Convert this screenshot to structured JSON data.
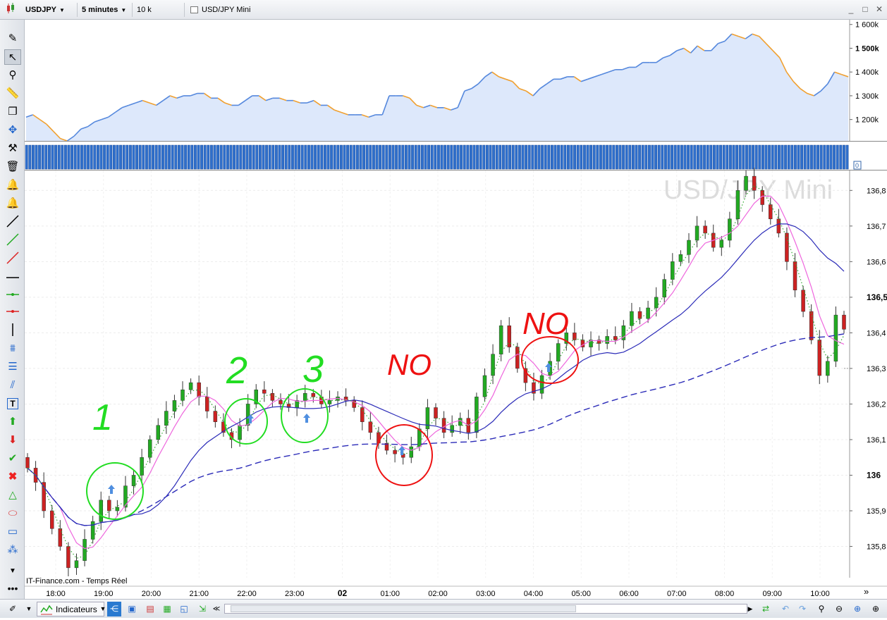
{
  "toolbar": {
    "symbol": "USDJPY",
    "timeframe": "5 minutes",
    "units": "10 k unités",
    "title": "USD/JPY Mini",
    "winbtns": [
      "_",
      "□",
      "✕"
    ]
  },
  "colors": {
    "up": "#22aa22",
    "down": "#cc2222",
    "ma_fast": "#ee66dd",
    "ma_slow": "#2b2bb8",
    "ma_long": "#2b2bb8",
    "dotted_green": "#33aa33",
    "equity_fill": "#dde8fb",
    "equity_line_up": "#5588dd",
    "equity_line_down": "#f0a030",
    "volume_bar": "#2f6fcc",
    "annotation_green": "#22dd22",
    "annotation_red": "#ee1111"
  },
  "chart_data": [
    {
      "type": "area",
      "name": "equity",
      "y_ticks": [
        "1 600k",
        "1 500k",
        "1 400k",
        "1 300k",
        "1 200k"
      ],
      "y_tick_values": [
        1600,
        1500,
        1400,
        1300,
        1200
      ],
      "y_bold": "1 500k",
      "ylim": [
        1110,
        1620
      ],
      "values": [
        1210,
        1220,
        1200,
        1180,
        1150,
        1120,
        1110,
        1130,
        1160,
        1170,
        1190,
        1200,
        1210,
        1230,
        1250,
        1260,
        1270,
        1280,
        1270,
        1260,
        1280,
        1300,
        1290,
        1300,
        1300,
        1310,
        1310,
        1290,
        1290,
        1270,
        1260,
        1260,
        1280,
        1300,
        1300,
        1280,
        1290,
        1290,
        1280,
        1280,
        1270,
        1270,
        1280,
        1260,
        1260,
        1240,
        1230,
        1220,
        1220,
        1220,
        1210,
        1220,
        1220,
        1300,
        1300,
        1300,
        1290,
        1260,
        1250,
        1260,
        1250,
        1250,
        1240,
        1250,
        1320,
        1330,
        1350,
        1380,
        1400,
        1380,
        1370,
        1360,
        1330,
        1320,
        1300,
        1330,
        1350,
        1370,
        1370,
        1380,
        1380,
        1360,
        1370,
        1380,
        1390,
        1400,
        1410,
        1410,
        1420,
        1420,
        1440,
        1440,
        1440,
        1460,
        1470,
        1490,
        1500,
        1480,
        1510,
        1490,
        1490,
        1520,
        1530,
        1560,
        1550,
        1540,
        1560,
        1550,
        1520,
        1490,
        1460,
        1400,
        1360,
        1330,
        1310,
        1300,
        1320,
        1350,
        1400,
        1390,
        1380
      ]
    },
    {
      "type": "bar",
      "name": "volume",
      "y_tick": "0"
    },
    {
      "type": "candlestick",
      "name": "USDJPY 5 minutes",
      "watermark": "USD/JPY Mini",
      "y_ticks": [
        "136,8",
        "136,7",
        "136,6",
        "136,5",
        "136,4",
        "136,3",
        "136,2",
        "136,1",
        "136",
        "135,9",
        "135,8"
      ],
      "y_tick_values": [
        136.8,
        136.7,
        136.6,
        136.5,
        136.4,
        136.3,
        136.2,
        136.1,
        136.0,
        135.9,
        135.8
      ],
      "y_bold": [
        "136,5",
        "136"
      ],
      "ylim": [
        135.712,
        136.856
      ],
      "x_ticks": [
        "18:00",
        "19:00",
        "20:00",
        "21:00",
        "22:00",
        "23:00",
        "02",
        "01:00",
        "02:00",
        "03:00",
        "04:00",
        "05:00",
        "06:00",
        "07:00",
        "08:00",
        "09:00",
        "10:00"
      ],
      "x_tick_bold": "02",
      "close": [
        136.02,
        135.98,
        135.9,
        135.85,
        135.8,
        135.74,
        135.76,
        135.82,
        135.87,
        135.93,
        135.9,
        135.91,
        135.97,
        136.0,
        136.05,
        136.1,
        136.14,
        136.18,
        136.21,
        136.24,
        136.26,
        136.22,
        136.18,
        136.15,
        136.12,
        136.1,
        136.14,
        136.2,
        136.24,
        136.23,
        136.21,
        136.2,
        136.19,
        136.21,
        136.23,
        136.22,
        136.2,
        136.21,
        136.22,
        136.21,
        136.19,
        136.15,
        136.12,
        136.09,
        136.07,
        136.06,
        136.05,
        136.08,
        136.13,
        136.19,
        136.16,
        136.12,
        136.14,
        136.16,
        136.12,
        136.22,
        136.28,
        136.34,
        136.42,
        136.36,
        136.3,
        136.26,
        136.23,
        136.28,
        136.32,
        136.37,
        136.4,
        136.38,
        136.36,
        136.38,
        136.37,
        136.39,
        136.38,
        136.42,
        136.46,
        136.44,
        136.47,
        136.5,
        136.55,
        136.6,
        136.62,
        136.66,
        136.7,
        136.68,
        136.64,
        136.66,
        136.72,
        136.8,
        136.84,
        136.8,
        136.76,
        136.72,
        136.68,
        136.6,
        136.52,
        136.46,
        136.38,
        136.28,
        136.32,
        136.45,
        136.41
      ],
      "series": [
        {
          "name": "",
          "style": "solid",
          "color": "#ee66dd",
          "period": 5
        },
        {
          "name": "",
          "style": "solid",
          "color": "#2b2bb8",
          "period": 14
        },
        {
          "name": "",
          "style": "dashed",
          "color": "#2b2bb8",
          "period": 60
        },
        {
          "name": "",
          "style": "dotted",
          "color": "#33aa33",
          "period": 3
        }
      ],
      "last_price_marker": "136,3"
    }
  ],
  "annotations": {
    "green_labels": [
      "1",
      "2",
      "3"
    ],
    "red_labels": [
      "NO",
      "NO"
    ]
  },
  "footer_source": "IT-Finance.com - Temps Réel",
  "bottombar": {
    "indicators_label": "Indicateurs"
  }
}
